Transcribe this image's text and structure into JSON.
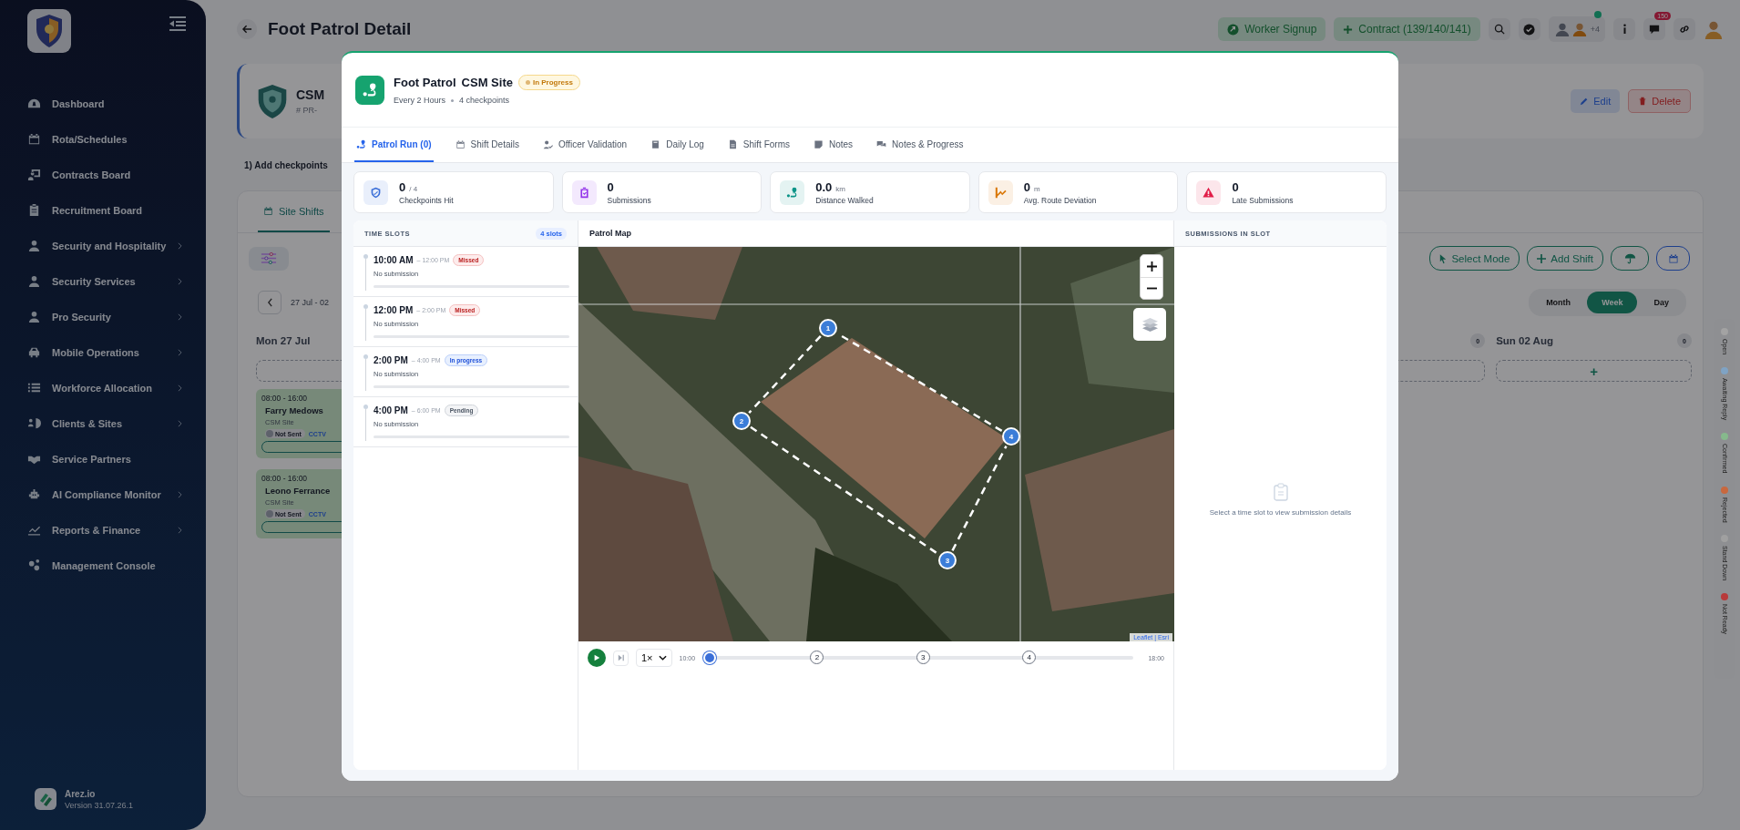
{
  "sidebar": {
    "items": [
      {
        "label": "Dashboard",
        "kind": "gauge",
        "submenu": false
      },
      {
        "label": "Rota/Schedules",
        "kind": "calendar",
        "submenu": false
      },
      {
        "label": "Contracts Board",
        "kind": "board",
        "submenu": false
      },
      {
        "label": "Recruitment Board",
        "kind": "clipboard",
        "submenu": false
      },
      {
        "label": "Security and Hospitality",
        "kind": "person",
        "submenu": true
      },
      {
        "label": "Security Services",
        "kind": "person",
        "submenu": true
      },
      {
        "label": "Pro Security",
        "kind": "person",
        "submenu": true
      },
      {
        "label": "Mobile Operations",
        "kind": "car",
        "submenu": true
      },
      {
        "label": "Workforce Allocation",
        "kind": "list",
        "submenu": true
      },
      {
        "label": "Clients & Sites",
        "kind": "clients",
        "submenu": true
      },
      {
        "label": "Service Partners",
        "kind": "handshake",
        "submenu": false
      },
      {
        "label": "AI Compliance Monitor",
        "kind": "robot",
        "submenu": true
      },
      {
        "label": "Reports & Finance",
        "kind": "chart",
        "submenu": true
      },
      {
        "label": "Management Console",
        "kind": "gears",
        "submenu": false
      }
    ],
    "footer": {
      "name": "Arez.io",
      "version": "Version 31.07.26.1"
    }
  },
  "topbar": {
    "title": "Foot Patrol Detail",
    "worker_signup": "Worker Signup",
    "contract": "Contract (139/140/141)",
    "avatar_more": "+4",
    "notifications": "150"
  },
  "site_header": {
    "name": "CSM",
    "reference": "# PR-",
    "edit": "Edit",
    "delete": "Delete"
  },
  "instruction": "1) Add checkpoints",
  "shifts_panel": {
    "tab": "Site Shifts",
    "select_mode": "Select Mode",
    "add_shift": "Add Shift",
    "date_range": "27 Jul - 02",
    "views": [
      {
        "label": "Month",
        "selected": false
      },
      {
        "label": "Week",
        "selected": true
      },
      {
        "label": "Day",
        "selected": false
      }
    ],
    "first_day": {
      "label": "Mon 27 Jul"
    },
    "column_6": {
      "count": "0"
    },
    "last_day": {
      "label": "Sun 02 Aug",
      "count": "0",
      "add": "+"
    },
    "shifts": [
      {
        "time": "08:00 - 16:00",
        "name": "Farry Medows",
        "site": "CSM Site",
        "status": "Not Sent",
        "tag": "CCTV"
      },
      {
        "time": "08:00 - 16:00",
        "name": "Leono Ferrance",
        "site": "CSM Site",
        "status": "Not Sent",
        "tag": "CCTV"
      }
    ],
    "legend": [
      {
        "label": "Open",
        "color": "#a3a3a3"
      },
      {
        "label": "Awaiting Reply",
        "color": "#7fa3c4"
      },
      {
        "label": "Confirmed",
        "color": "#86b98c"
      },
      {
        "label": "Rejected",
        "color": "#c8683e"
      },
      {
        "label": "Stand Down",
        "color": "#a0a0a0"
      },
      {
        "label": "Not Ready",
        "color": "#b83a3a"
      }
    ]
  },
  "modal": {
    "title": "Foot Patrol",
    "site": "CSM Site",
    "status": {
      "label": "In Progress",
      "kind": "in_progress"
    },
    "frequency": "Every 2 Hours",
    "checkpoints": "4 checkpoints",
    "tabs": [
      {
        "label": "Patrol Run (0)",
        "kind": "route",
        "selected": true
      },
      {
        "label": "Shift Details",
        "kind": "calendar",
        "selected": false
      },
      {
        "label": "Officer Validation",
        "kind": "usercheck",
        "selected": false
      },
      {
        "label": "Daily Log",
        "kind": "book",
        "selected": false
      },
      {
        "label": "Shift Forms",
        "kind": "file",
        "selected": false
      },
      {
        "label": "Notes",
        "kind": "note",
        "selected": false
      },
      {
        "label": "Notes & Progress",
        "kind": "chat",
        "selected": false
      }
    ],
    "stats": [
      {
        "value": "0",
        "unit": "/ 4",
        "label": "Checkpoints Hit",
        "kind": "shield",
        "color": "#3b6fd8"
      },
      {
        "value": "0",
        "label": "Submissions",
        "kind": "clipcheck",
        "color": "#9333ea"
      },
      {
        "value": "0.0",
        "unit": "km",
        "label": "Distance Walked",
        "kind": "route",
        "color": "#0d9488"
      },
      {
        "value": "0",
        "unit": "m",
        "label": "Avg. Route Deviation",
        "kind": "deviation",
        "color": "#d97706"
      },
      {
        "value": "0",
        "label": "Late Submissions",
        "kind": "warning",
        "color": "#e11d48"
      }
    ],
    "time_slots": {
      "title": "TIME SLOTS",
      "count": "4 slots",
      "items": [
        {
          "start": "10:00 AM",
          "end": "– 12:00 PM",
          "status": {
            "label": "Missed",
            "kind": "missed"
          },
          "note": "No submission",
          "level": 0
        },
        {
          "start": "12:00 PM",
          "end": "– 2:00 PM",
          "status": {
            "label": "Missed",
            "kind": "missed"
          },
          "note": "No submission",
          "level": 0
        },
        {
          "start": "2:00 PM",
          "end": "– 4:00 PM",
          "status": {
            "label": "In progress",
            "kind": "in_progress"
          },
          "note": "No submission",
          "level": 0
        },
        {
          "start": "4:00 PM",
          "end": "– 6:00 PM",
          "status": {
            "label": "Pending",
            "kind": "pending"
          },
          "note": "No submission",
          "level": 0
        }
      ]
    },
    "map": {
      "title": "Patrol Map",
      "checkpoints": [
        "1",
        "2",
        "3",
        "4"
      ],
      "attribution": "Leaflet | Esri"
    },
    "player": {
      "speed": "1×",
      "start": "10:00",
      "end": "18:00",
      "level": 0,
      "marks": [
        "2",
        "3",
        "4"
      ]
    },
    "submissions": {
      "title": "SUBMISSIONS IN SLOT",
      "empty": "Select a time slot to view submission details"
    }
  }
}
